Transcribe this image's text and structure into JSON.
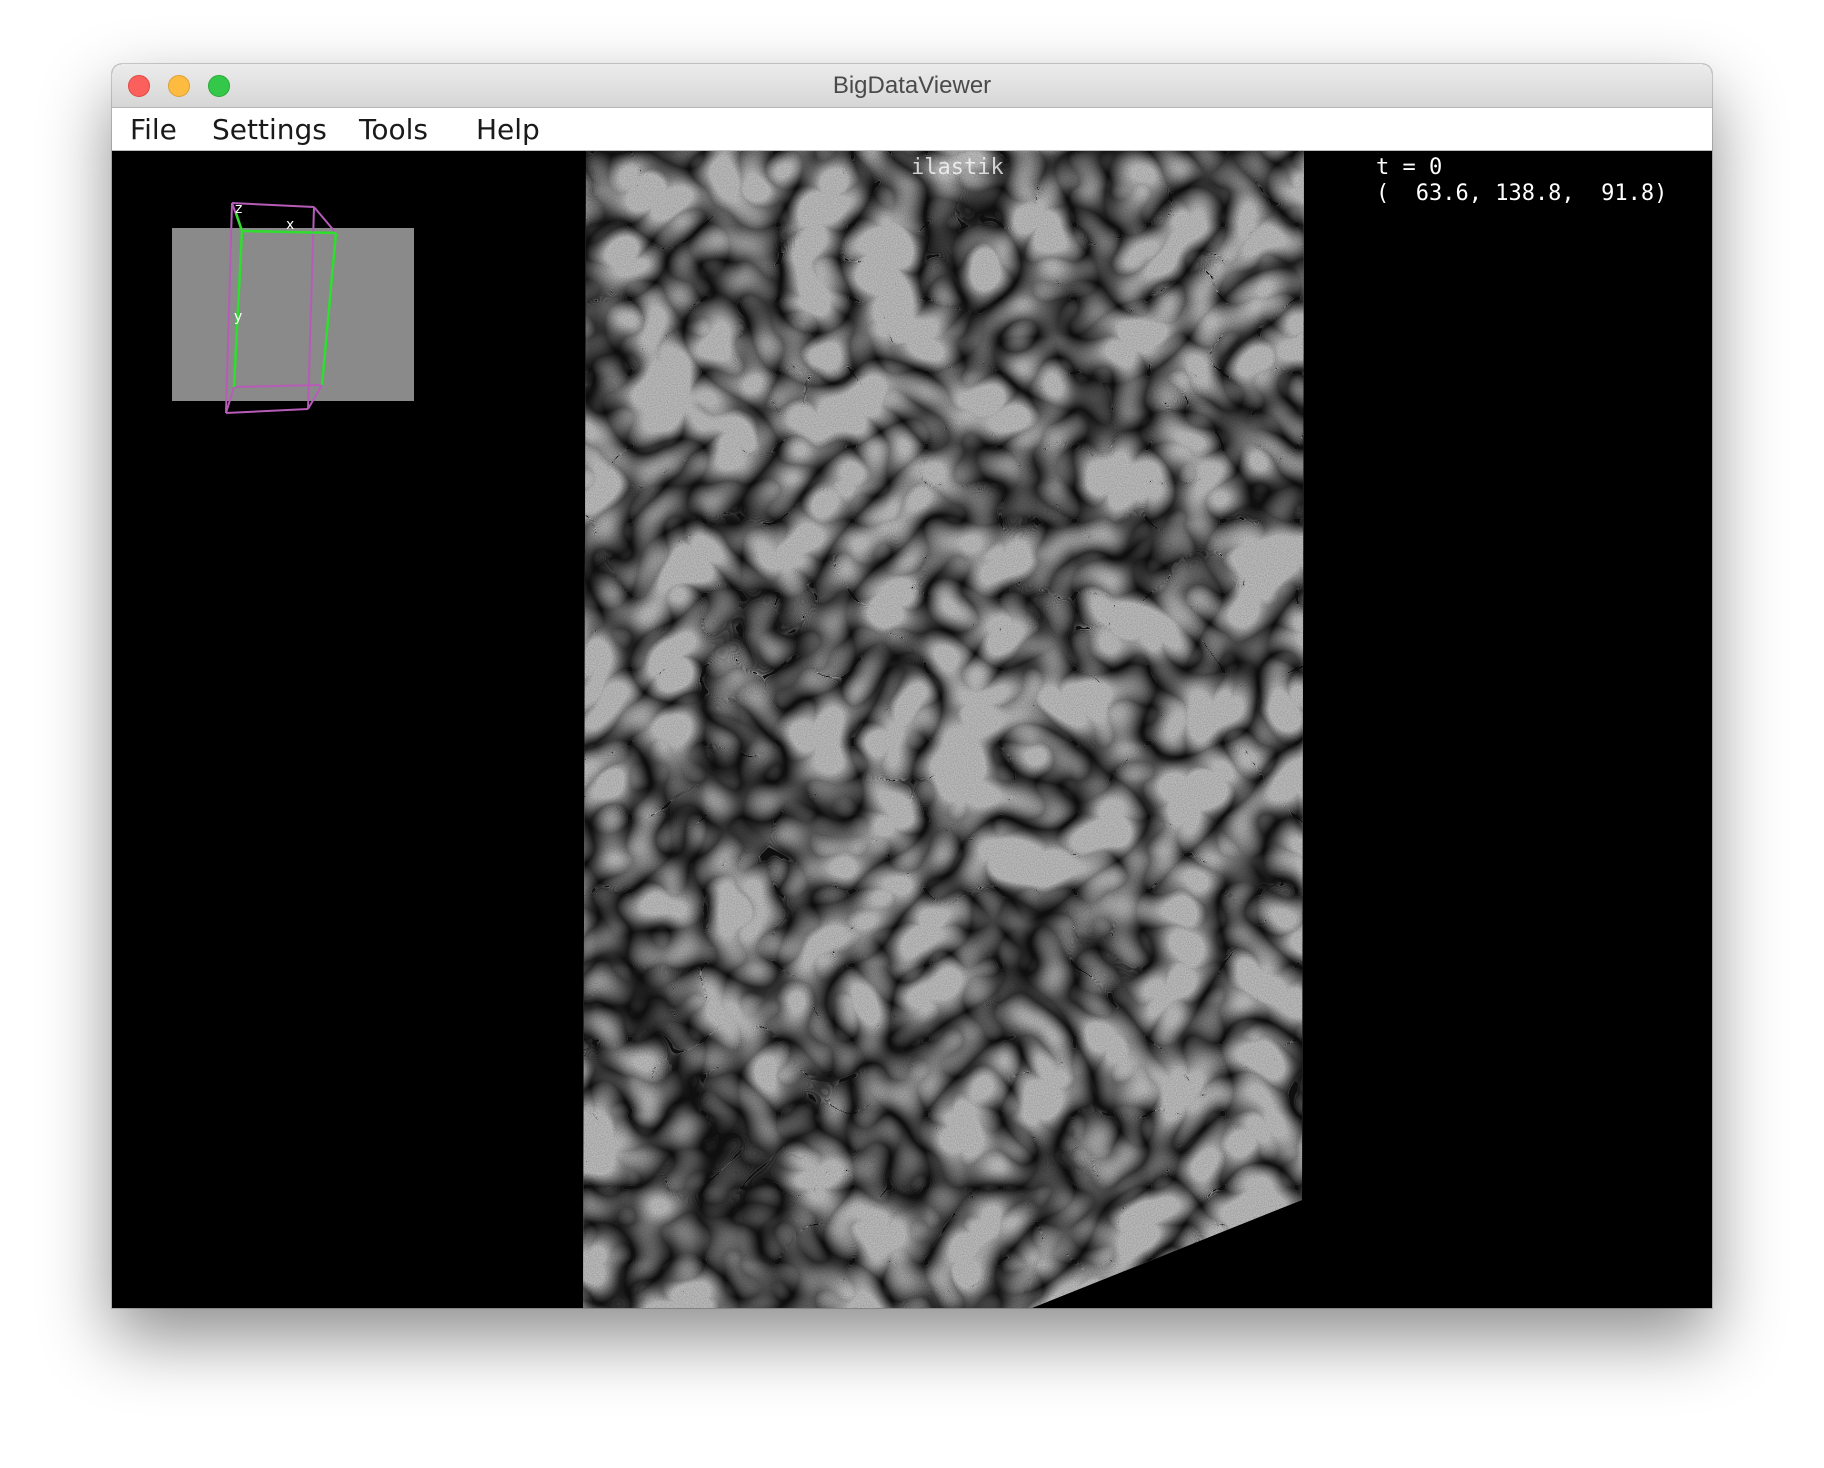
{
  "window": {
    "title": "BigDataViewer"
  },
  "menubar": {
    "items": [
      {
        "label": "File"
      },
      {
        "label": "Settings"
      },
      {
        "label": "Tools"
      },
      {
        "label": "Help"
      }
    ]
  },
  "viewer": {
    "source_name": "ilastik",
    "timepoint_text": "t = 0",
    "mouse_coords_text": "(  63.6, 138.8,  91.8)"
  },
  "navigator": {
    "axis_labels": {
      "x": "x",
      "y": "y",
      "z": "z"
    },
    "colors": {
      "box": "#b65cb8",
      "slice_plane": "#8a8a8a",
      "axes": "#2ee02e"
    }
  }
}
